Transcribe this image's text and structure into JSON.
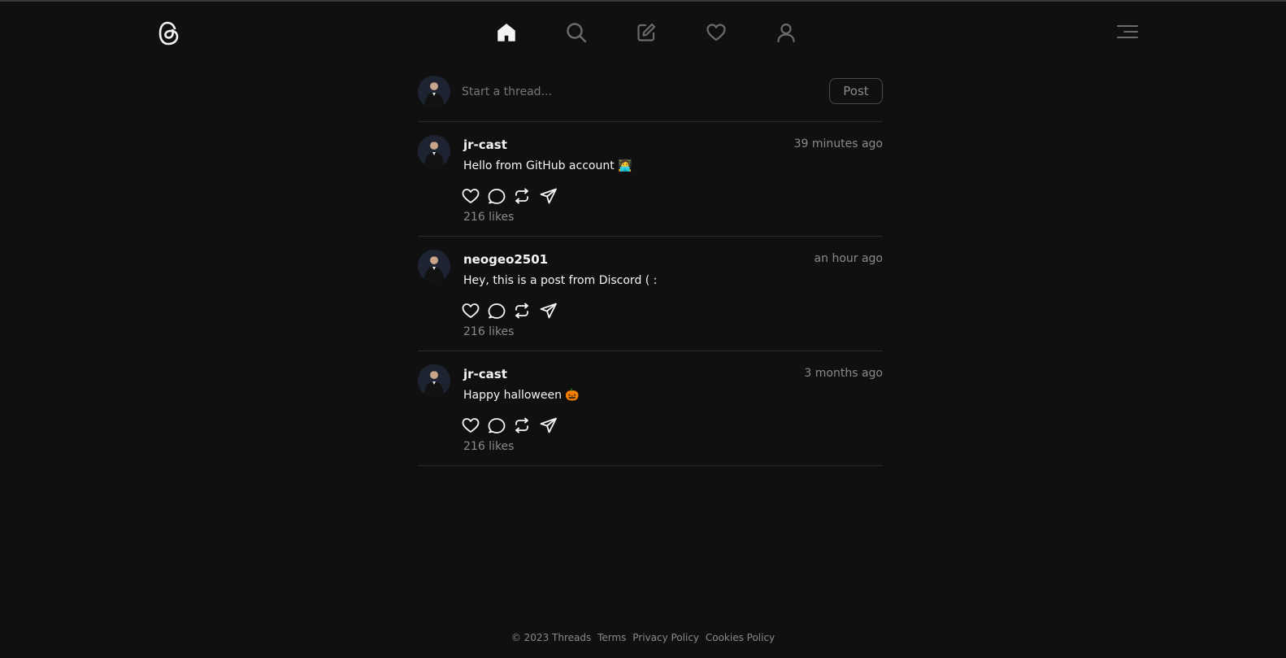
{
  "header": {
    "logo_icon": "threads-logo-icon",
    "nav": [
      {
        "name": "home",
        "icon": "home-icon",
        "active": true
      },
      {
        "name": "search",
        "icon": "search-icon",
        "active": false
      },
      {
        "name": "compose",
        "icon": "compose-icon",
        "active": false
      },
      {
        "name": "activity",
        "icon": "heart-icon",
        "active": false
      },
      {
        "name": "profile",
        "icon": "user-icon",
        "active": false
      }
    ],
    "menu_icon": "menu-icon"
  },
  "composer": {
    "placeholder": "Start a thread...",
    "post_label": "Post"
  },
  "posts": [
    {
      "username": "jr-cast",
      "time": "39 minutes ago",
      "content": "Hello from GitHub account 🧑‍💻",
      "likes": "216 likes"
    },
    {
      "username": "neogeo2501",
      "time": "an hour ago",
      "content": "Hey, this is a post from Discord ( :",
      "likes": "216 likes"
    },
    {
      "username": "jr-cast",
      "time": "3 months ago",
      "content": "Happy halloween 🎃",
      "likes": "216 likes"
    }
  ],
  "footer": {
    "copyright": "© 2023 Threads",
    "terms": "Terms",
    "privacy": "Privacy Policy",
    "cookies": "Cookies Policy"
  },
  "colors": {
    "background": "#101010",
    "text": "#f3f5f7",
    "muted": "#8a8a8a",
    "divider": "#2a2a2a"
  }
}
